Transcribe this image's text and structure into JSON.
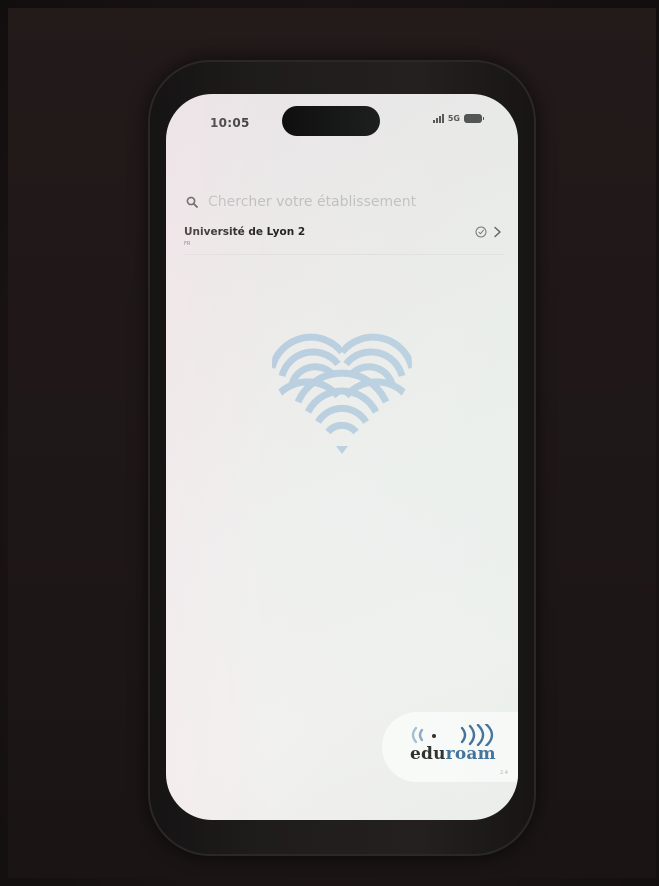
{
  "status_bar": {
    "time": "10:05",
    "network": "5G"
  },
  "search": {
    "placeholder": "Chercher votre établissement"
  },
  "institutions": [
    {
      "name": "Université de Lyon 2",
      "country": "FR"
    }
  ],
  "brand": {
    "edu": "edu",
    "roam": "roam",
    "version": "2.4",
    "colors": {
      "heart": "#b9cfe0",
      "roam": "#2b5f8e",
      "edu": "#1a1a1a"
    }
  },
  "icons": {
    "search": "search-icon",
    "check": "check-circle-icon",
    "chevron": "chevron-right-icon",
    "heart": "eduroam-heart-icon",
    "waves": "wifi-waves-icon"
  }
}
